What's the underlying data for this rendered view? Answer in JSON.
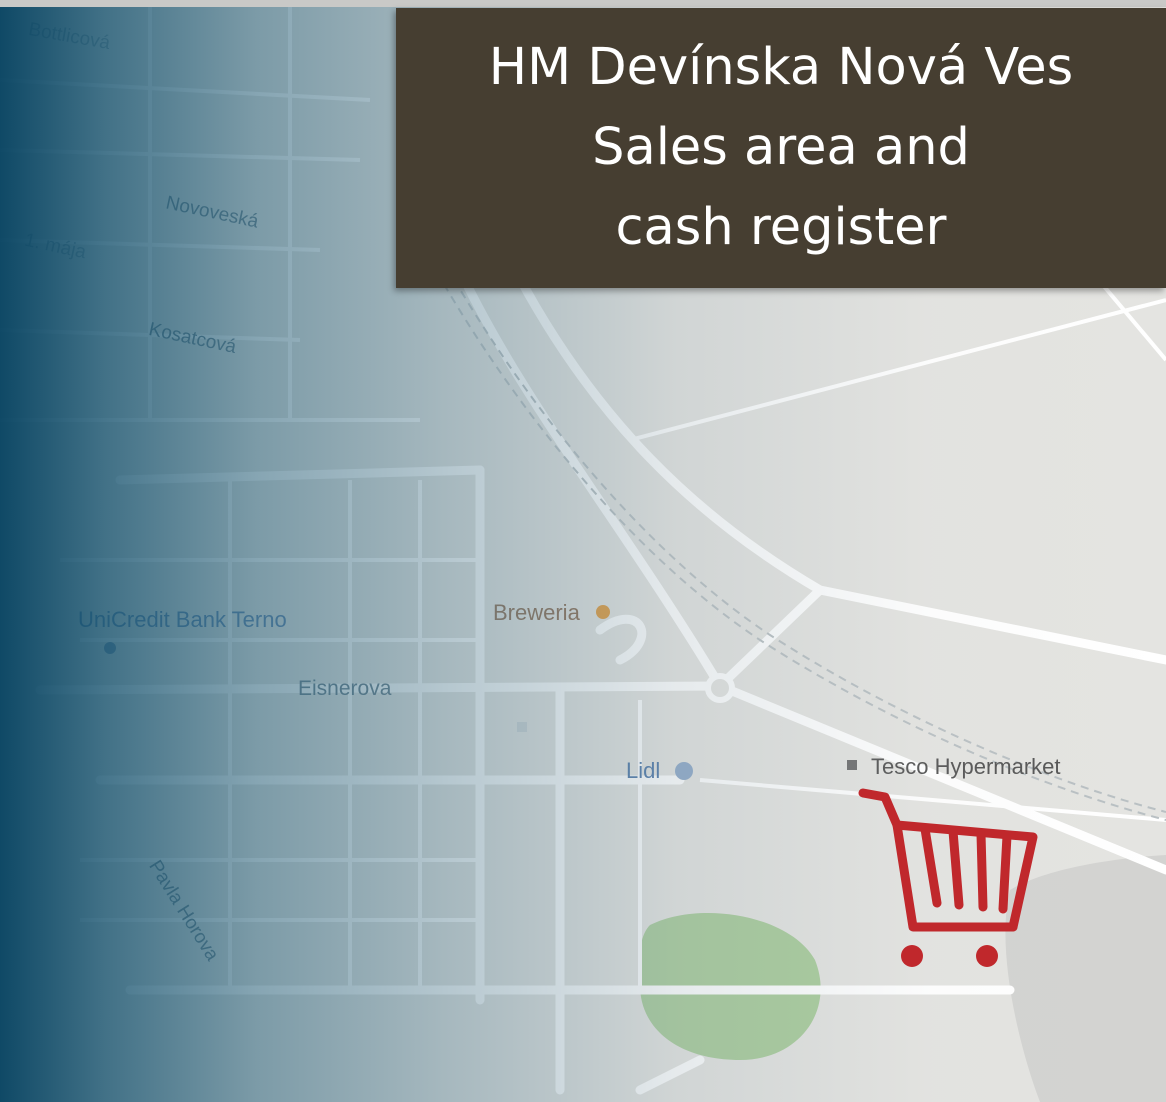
{
  "title": {
    "line1": "HM Devínska Nová Ves",
    "line2": "Sales area and",
    "line3": "cash register"
  },
  "map": {
    "streets": {
      "bottlicova": "Bottlicová",
      "novoveska": "Novoveská",
      "maja": "1. mája",
      "kosatcova": "Kosatcová",
      "eisnerova": "Eisnerova",
      "pavla_horova": "Pavla Horova"
    },
    "pois": {
      "unicredit": "UniCredit Bank Terno",
      "breweria": "Breweria",
      "lidl": "Lidl",
      "tesco": "Tesco Hypermarket"
    }
  },
  "icons": {
    "cart": "shopping-cart-icon",
    "cart_color": "#c0282c",
    "title_bg": "#463e31"
  }
}
